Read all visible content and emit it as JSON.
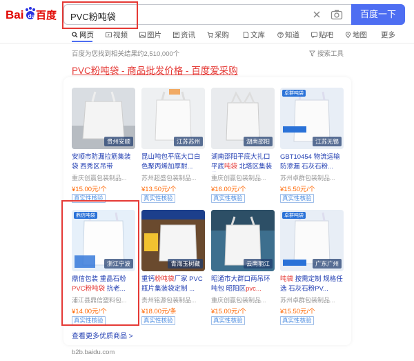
{
  "logo": {
    "text_bai": "Bai",
    "text_du": "du",
    "text_cn": "百度",
    "icon": "baidu-paw-icon"
  },
  "search": {
    "query": "PVC粉吨袋",
    "button_label": "百度一下",
    "clear_icon": "close-icon",
    "camera_icon": "camera-icon"
  },
  "tabs": [
    {
      "label": "网页",
      "icon": "search-icon"
    },
    {
      "label": "视频",
      "icon": "video-icon"
    },
    {
      "label": "图片",
      "icon": "image-icon"
    },
    {
      "label": "资讯",
      "icon": "news-icon"
    },
    {
      "label": "采购",
      "icon": "cart-icon"
    },
    {
      "label": "文库",
      "icon": "doc-icon"
    },
    {
      "label": "知道",
      "icon": "question-icon"
    },
    {
      "label": "贴吧",
      "icon": "chat-icon"
    },
    {
      "label": "地图",
      "icon": "map-pin-icon"
    },
    {
      "label": "更多",
      "icon": ""
    }
  ],
  "result_count": "百度为您找到相关结果约2,510,000个",
  "search_tools": "搜索工具",
  "result": {
    "title_em": "PVC粉吨袋",
    "title_rest": " - 商品批发价格 - 百度爱采购"
  },
  "colors": {
    "brand_blue": "#4e6ef2",
    "highlight_red": "#e53935",
    "price_orange": "#f60"
  },
  "products": [
    {
      "title_a": "安顺市防漏拉筋集装袋 西秀区吊带",
      "title_r": "",
      "title_b": "",
      "shop": "重庆创赢包装制品...",
      "price": "¥15.00元/个",
      "verify": "真实性核验",
      "tag": "贵州安顺",
      "badge": ""
    },
    {
      "title_a": "昆山吨包平底大口白色聚丙烯加厚耐...",
      "title_r": "",
      "title_b": "",
      "shop": "苏州超盛包装制品...",
      "price": "¥13.50元/个",
      "verify": "真实性核验",
      "tag": "江苏苏州",
      "badge": ""
    },
    {
      "title_a": "湖南邵阳平底大扎口平底",
      "title_r": "吨袋",
      "title_b": " 北塔区集装袋邵...",
      "shop": "重庆创赢包装制品...",
      "price": "¥16.00元/个",
      "verify": "真实性核验",
      "tag": "湖南邵阳",
      "badge": ""
    },
    {
      "title_a": "GBT10454 物流运输防渗漏 石灰石粉...",
      "title_r": "",
      "title_b": "",
      "shop": "苏州卓群包装制品...",
      "price": "¥15.50元/个",
      "verify": "真实性核验",
      "tag": "江苏无锡",
      "badge": "卓群吨袋"
    },
    {
      "title_a": "鼎信包装 重晶石粉 ",
      "title_r": "PVC粉吨袋",
      "title_b": " 抗老...",
      "shop": "浦江县鼎信塑料包...",
      "price": "¥14.00元/个",
      "verify": "真实性核验",
      "tag": "浙江宁波",
      "badge": "鼎信吨袋"
    },
    {
      "title_a": "重钙",
      "title_r": "粉吨袋",
      "title_b": "厂家 PVC瓶片集装袋定制 ...",
      "shop": "贵州铭源包装制品...",
      "price": "¥18.00元/条",
      "verify": "真实性核验",
      "tag": "青海玉树藏",
      "badge": ""
    },
    {
      "title_a": "昭通市大群口两吊环吨包 昭阳区",
      "title_r": "pvc...",
      "title_b": "",
      "shop": "重庆创赢包装制品...",
      "price": "¥15.00元/个",
      "verify": "真实性核验",
      "tag": "云南丽江",
      "badge": ""
    },
    {
      "title_a": "",
      "title_r": "吨袋",
      "title_b": " 按需定制 规格任选 石灰石粉PV...",
      "shop": "苏州卓群包装制品...",
      "price": "¥15.50元/个",
      "verify": "真实性核验",
      "tag": "广东广州",
      "badge": "卓群吨袋"
    }
  ],
  "more_link": "查看更多优质商品 >",
  "source_url": "b2b.baidu.com"
}
